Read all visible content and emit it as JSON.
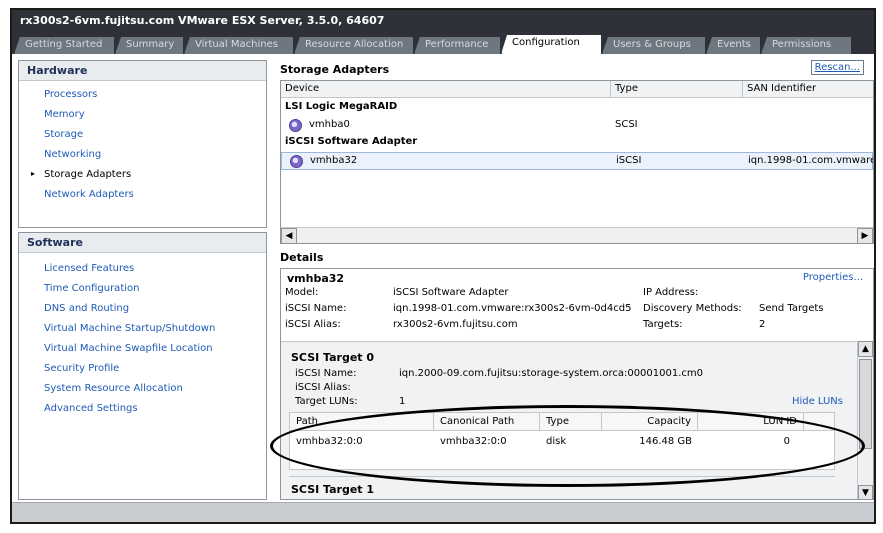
{
  "window": {
    "title": "rx300s2-6vm.fujitsu.com VMware ESX Server, 3.5.0, 64607"
  },
  "tabs": [
    {
      "label": "Getting Started",
      "active": false
    },
    {
      "label": "Summary",
      "active": false
    },
    {
      "label": "Virtual Machines",
      "active": false
    },
    {
      "label": "Resource Allocation",
      "active": false
    },
    {
      "label": "Performance",
      "active": false
    },
    {
      "label": "Configuration",
      "active": true
    },
    {
      "label": "Users & Groups",
      "active": false
    },
    {
      "label": "Events",
      "active": false
    },
    {
      "label": "Permissions",
      "active": false
    }
  ],
  "hardware": {
    "header": "Hardware",
    "items": [
      "Processors",
      "Memory",
      "Storage",
      "Networking",
      "Storage Adapters",
      "Network Adapters"
    ],
    "selected": "Storage Adapters"
  },
  "software": {
    "header": "Software",
    "items": [
      "Licensed Features",
      "Time Configuration",
      "DNS and Routing",
      "Virtual Machine Startup/Shutdown",
      "Virtual Machine Swapfile Location",
      "Security Profile",
      "System Resource Allocation",
      "Advanced Settings"
    ]
  },
  "storage_adapters": {
    "heading": "Storage Adapters",
    "rescan_label": "Rescan...",
    "columns": [
      "Device",
      "Type",
      "SAN Identifier"
    ],
    "groups": [
      {
        "name": "LSI Logic MegaRAID",
        "rows": [
          {
            "device": "vmhba0",
            "type": "SCSI",
            "san": ""
          }
        ]
      },
      {
        "name": "iSCSI Software Adapter",
        "rows": [
          {
            "device": "vmhba32",
            "type": "iSCSI",
            "san": "iqn.1998-01.com.vmware:."
          }
        ]
      }
    ]
  },
  "details": {
    "heading": "Details",
    "adapter_name": "vmhba32",
    "properties_link": "Properties...",
    "fields": {
      "model_label": "Model:",
      "model_value": "iSCSI Software Adapter",
      "iscsi_name_label": "iSCSI Name:",
      "iscsi_name_value": "iqn.1998-01.com.vmware:rx300s2-6vm-0d4cd5",
      "iscsi_alias_label": "iSCSI Alias:",
      "iscsi_alias_value": "rx300s2-6vm.fujitsu.com",
      "ip_label": "IP Address:",
      "ip_value": "",
      "discovery_label": "Discovery Methods:",
      "discovery_value": "Send Targets",
      "targets_label": "Targets:",
      "targets_value": "2"
    },
    "target0": {
      "title": "SCSI Target 0",
      "iscsi_name_label": "iSCSI Name:",
      "iscsi_name_value": "iqn.2000-09.com.fujitsu:storage-system.orca:00001001.cm0",
      "iscsi_alias_label": "iSCSI Alias:",
      "target_luns_label": "Target LUNs:",
      "target_luns_value": "1",
      "hide_luns": "Hide LUNs",
      "lun_columns": [
        "Path",
        "Canonical Path",
        "Type",
        "Capacity",
        "LUN ID"
      ],
      "lun_rows": [
        {
          "path": "vmhba32:0:0",
          "canonical": "vmhba32:0:0",
          "type": "disk",
          "capacity": "146.48 GB",
          "lun_id": "0"
        }
      ]
    },
    "target1": {
      "title": "SCSI Target 1"
    }
  }
}
